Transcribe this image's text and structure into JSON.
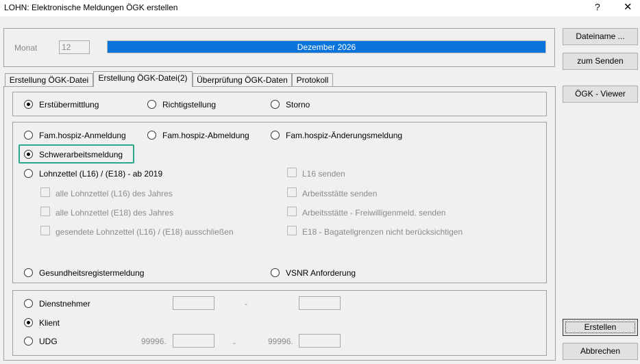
{
  "window": {
    "title": "LOHN: Elektronische Meldungen ÖGK erstellen",
    "help": "?",
    "close": "✕"
  },
  "header": {
    "monat_label": "Monat",
    "monat_value": "12",
    "month_display": "Dezember   2026"
  },
  "buttons": {
    "dateiname": "Dateiname ...",
    "zum_senden": "zum Senden",
    "oegk_viewer": "ÖGK - Viewer",
    "erstellen": "Erstellen",
    "abbrechen": "Abbrechen"
  },
  "tabs": [
    {
      "label": "Erstellung ÖGK-Datei"
    },
    {
      "label": "Erstellung ÖGK-Datei(2)"
    },
    {
      "label": "Überprüfung ÖGK-Daten"
    },
    {
      "label": "Protokoll"
    }
  ],
  "group1": {
    "erstuebermittlung": "Erstübermittlung",
    "richtigstellung": "Richtigstellung",
    "storno": "Storno"
  },
  "group2": {
    "famhospiz_anmeldung": "Fam.hospiz-Anmeldung",
    "famhospiz_abmeldung": "Fam.hospiz-Abmeldung",
    "famhospiz_aenderung": "Fam.hospiz-Änderungsmeldung",
    "schwerarbeit": "Schwerarbeitsmeldung",
    "lohnzettel": "Lohnzettel (L16) / (E18) - ab 2019",
    "cb_alle_l16": "alle Lohnzettel (L16) des Jahres",
    "cb_alle_e18": "alle Lohnzettel (E18) des Jahres",
    "cb_gesendete": "gesendete Lohnzettel (L16) / (E18) ausschließen",
    "cb_l16_senden": "L16 senden",
    "cb_arbeitsstaette": "Arbeitsstätte senden",
    "cb_arbeitsstaette_frei": "Arbeitsstätte - Freiwilligenmeld. senden",
    "cb_e18_bagatell": "E18 - Bagatellgrenzen nicht berücksichtigen",
    "gesundheitsregister": "Gesundheitsregistermeldung",
    "vsnr": "VSNR Anforderung"
  },
  "group3": {
    "dienstnehmer": "Dienstnehmer",
    "klient": "Klient",
    "udg": "UDG",
    "dash": "-",
    "udg_prefix_from": "99996.",
    "udg_prefix_to": "99996."
  },
  "colors": {
    "accent": "#0a74da",
    "highlight": "#2aa98a"
  }
}
